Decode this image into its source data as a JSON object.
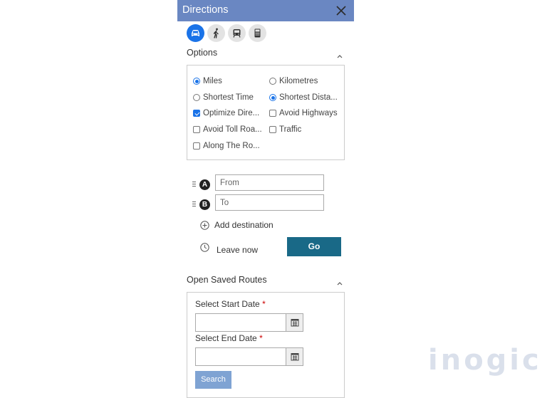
{
  "header": {
    "title": "Directions"
  },
  "modes": [
    {
      "name": "car",
      "icon": "car-icon",
      "active": true
    },
    {
      "name": "walk",
      "icon": "walking-icon",
      "active": false
    },
    {
      "name": "transit",
      "icon": "train-icon",
      "active": false
    },
    {
      "name": "truck",
      "icon": "truck-icon",
      "active": false
    }
  ],
  "options": {
    "title": "Options",
    "items": {
      "miles": "Miles",
      "kilometres": "Kilometres",
      "shortest_time": "Shortest Time",
      "shortest_distance": "Shortest Dista...",
      "optimize": "Optimize Dire...",
      "avoid_highways": "Avoid Highways",
      "avoid_toll": "Avoid Toll Roa...",
      "traffic": "Traffic",
      "along_route": "Along The Ro..."
    },
    "state": {
      "miles": true,
      "kilometres": false,
      "shortest_time": false,
      "shortest_distance": true,
      "optimize": true,
      "avoid_highways": false,
      "avoid_toll": false,
      "traffic": false,
      "along_route": false
    }
  },
  "waypoints": [
    {
      "marker": "A",
      "placeholder": "From",
      "value": ""
    },
    {
      "marker": "B",
      "placeholder": "To",
      "value": ""
    }
  ],
  "add_destination": "Add destination",
  "leave_now": "Leave now",
  "go_button": "Go",
  "saved_routes": {
    "title": "Open Saved Routes",
    "start_label": "Select Start Date",
    "end_label": "Select End Date",
    "required_mark": "*",
    "search_button": "Search"
  },
  "watermark": {
    "text": "inogic"
  },
  "colors": {
    "header": "#6a87c2",
    "accent": "#1a73e8",
    "go": "#196987",
    "search": "#7fa3d3",
    "required": "#cc0000"
  }
}
